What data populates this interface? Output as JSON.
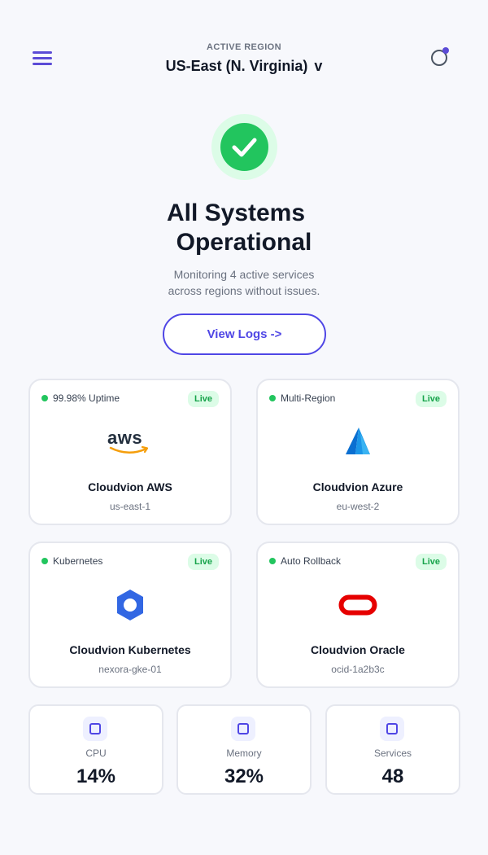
{
  "header": {
    "region_label": "ACTIVE REGION",
    "region_value": "US-East (N. Virginia)",
    "region_chevron": "v",
    "menu_icon": "hamburger-menu-icon",
    "notification_icon": "notification-bell-icon"
  },
  "hero": {
    "status_icon": "check-icon",
    "title_line1": "All Systems",
    "title_line2": "Operational",
    "subtitle_line1": "Monitoring 4 active services",
    "subtitle_line2": "across regions without issues.",
    "cta_label": "View Logs  ->"
  },
  "services": [
    {
      "stat": "99.98% Uptime",
      "badge": "Live",
      "logo": "aws-logo",
      "name": "Cloudvion AWS",
      "region": "us-east-1"
    },
    {
      "stat": "Multi-Region",
      "badge": "Live",
      "logo": "azure-logo",
      "name": "Cloudvion Azure",
      "region": "eu-west-2"
    },
    {
      "stat": "Kubernetes",
      "badge": "Live",
      "logo": "kubernetes-logo",
      "name": "Cloudvion Kubernetes",
      "region": "nexora-gke-01"
    },
    {
      "stat": "Auto Rollback",
      "badge": "Live",
      "logo": "oracle-logo",
      "name": "Cloudvion Oracle",
      "region": "ocid-1a2b3c"
    }
  ],
  "aws_wordmark": "aws",
  "metrics": [
    {
      "label": "CPU",
      "value": "14%",
      "icon": "chip-icon"
    },
    {
      "label": "Memory",
      "value": "32%",
      "icon": "memory-icon"
    },
    {
      "label": "Services",
      "value": "48",
      "icon": "services-icon"
    }
  ],
  "colors": {
    "accent": "#4f46e5",
    "success": "#22c55e",
    "success_bg": "#dcfce7",
    "background": "#f7f8fc"
  }
}
